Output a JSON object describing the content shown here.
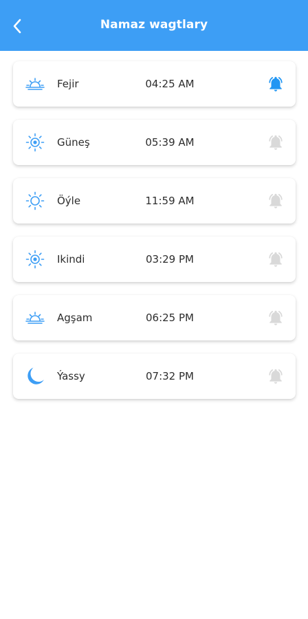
{
  "header": {
    "title": "Namaz wagtlary",
    "back_icon": "arrow-back-icon"
  },
  "colors": {
    "accent": "#3d9ef5",
    "bell_active": "#2196f3",
    "bell_inactive": "#d9d9d9",
    "text": "#2d2d2d"
  },
  "prayers": [
    {
      "name": "Fejir",
      "time": "04:25 AM",
      "icon": "sunrise-icon",
      "alarm_on": true
    },
    {
      "name": "Güneş",
      "time": "05:39 AM",
      "icon": "sun-icon",
      "alarm_on": false
    },
    {
      "name": "Öýle",
      "time": "11:59 AM",
      "icon": "sun-icon",
      "alarm_on": false
    },
    {
      "name": "Ikindi",
      "time": "03:29 PM",
      "icon": "sun-icon",
      "alarm_on": false
    },
    {
      "name": "Agşam",
      "time": "06:25 PM",
      "icon": "sunset-icon",
      "alarm_on": false
    },
    {
      "name": "Ýassy",
      "time": "07:32 PM",
      "icon": "moon-icon",
      "alarm_on": false
    }
  ]
}
